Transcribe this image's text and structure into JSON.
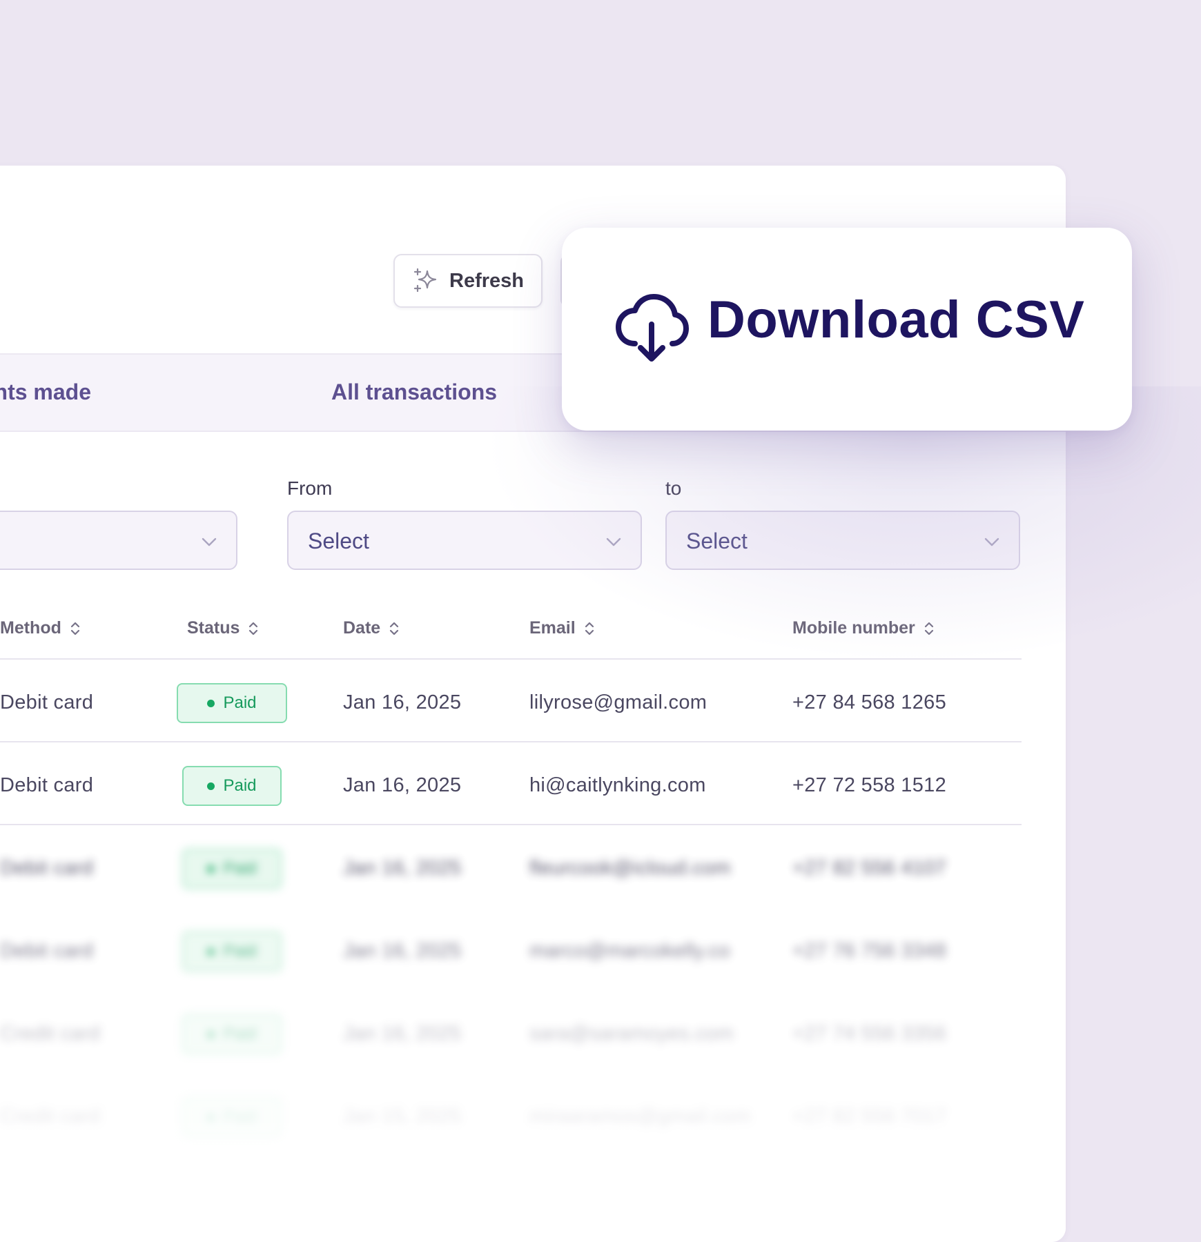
{
  "toolbar": {
    "refresh_label": "Refresh",
    "refresh_icon": "sparkle-icon"
  },
  "tabs": [
    {
      "label": "yments made"
    },
    {
      "label": "All transactions"
    }
  ],
  "filters": {
    "from": {
      "label": "From",
      "value": "Select"
    },
    "to": {
      "label": "to",
      "value": "Select"
    }
  },
  "table": {
    "columns": [
      "Method",
      "Status",
      "Date",
      "Email",
      "Mobile number"
    ],
    "rows": [
      {
        "method": "Debit card",
        "status": "Paid",
        "date": "Jan 16, 2025",
        "email": "lilyrose@gmail.com",
        "mobile": "+27 84 568 1265"
      },
      {
        "method": "Debit card",
        "status": "Paid",
        "date": "Jan 16, 2025",
        "email": "hi@caitlynking.com",
        "mobile": "+27 72 558 1512"
      },
      {
        "method": "Debit card",
        "status": "Paid",
        "date": "Jan 16, 2025",
        "email": "fleurcook@icloud.com",
        "mobile": "+27 82 556 4107"
      },
      {
        "method": "Debit card",
        "status": "Paid",
        "date": "Jan 16, 2025",
        "email": "marco@marcokelly.co",
        "mobile": "+27 76 756 3348"
      },
      {
        "method": "Credit card",
        "status": "Paid",
        "date": "Jan 16, 2025",
        "email": "sara@saramoyes.com",
        "mobile": "+27 74 556 3356"
      },
      {
        "method": "Credit card",
        "status": "Paid",
        "date": "Jan 15, 2025",
        "email": "miraaramos@gmail.com",
        "mobile": "+27 82 556 7017"
      }
    ]
  },
  "download_popup": {
    "label": "Download CSV",
    "icon": "cloud-download-icon"
  },
  "colors": {
    "background": "#ece6f2",
    "accent": "#1e1560",
    "tab_text": "#5d5090",
    "paid_green": "#169a5c"
  }
}
